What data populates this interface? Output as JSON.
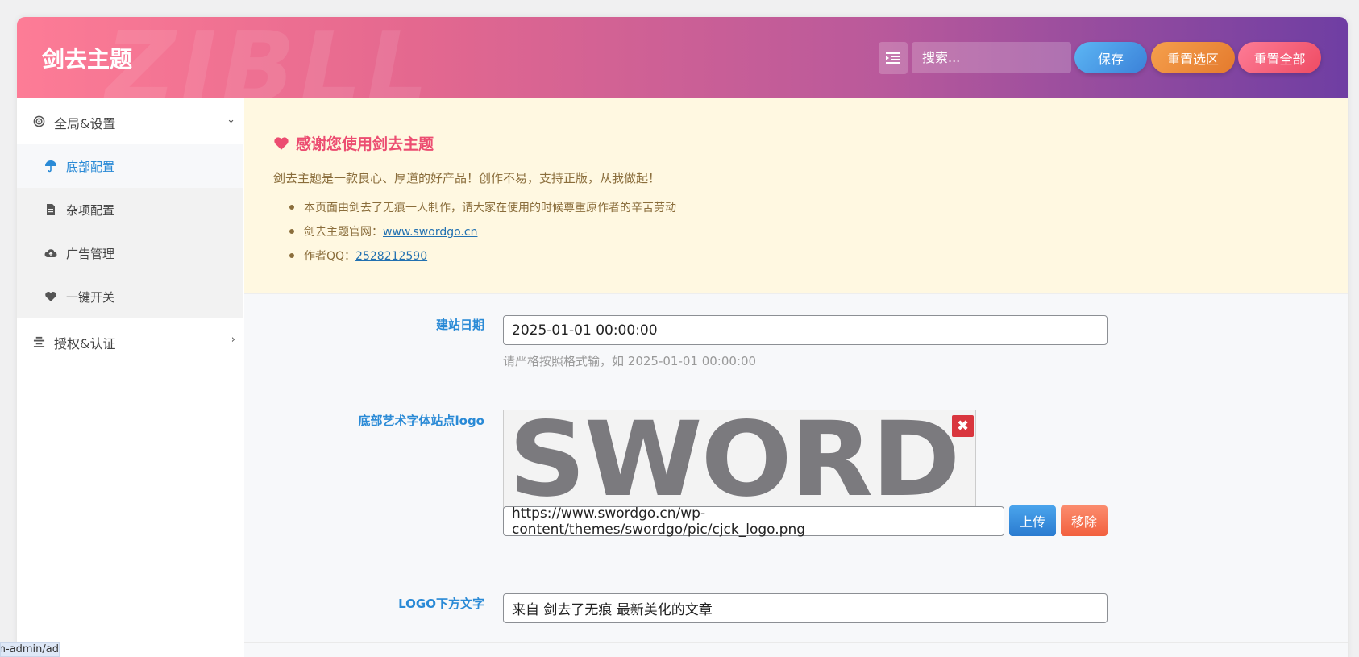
{
  "header": {
    "brand": "剑去主题",
    "watermark": "ZIBLL",
    "search_placeholder": "搜索...",
    "save_label": "保存",
    "reset_section_label": "重置选区",
    "reset_all_label": "重置全部"
  },
  "sidebar": {
    "sections": [
      {
        "label": "全局&设置",
        "icon": "target-icon",
        "expanded": true
      },
      {
        "label": "授权&认证",
        "icon": "align-icon",
        "expanded": false
      }
    ],
    "items": [
      {
        "label": "底部配置",
        "icon": "umbrella-icon",
        "active": true
      },
      {
        "label": "杂项配置",
        "icon": "file-icon",
        "active": false
      },
      {
        "label": "广告管理",
        "icon": "cloud-upload-icon",
        "active": false
      },
      {
        "label": "一键开关",
        "icon": "heart-icon",
        "active": false
      }
    ]
  },
  "notice": {
    "title": "感谢您使用剑去主题",
    "description": "剑去主题是一款良心、厚道的好产品！创作不易，支持正版，从我做起！",
    "bullets": [
      {
        "text": "本页面由剑去了无痕一人制作，请大家在使用的时候尊重原作者的辛苦劳动",
        "link": ""
      },
      {
        "text": "剑去主题官网：",
        "link": "www.swordgo.cn"
      },
      {
        "text": "作者QQ：",
        "link": "2528212590"
      }
    ]
  },
  "fields": {
    "site_date": {
      "label": "建站日期",
      "value": "2025-01-01 00:00:00",
      "help": "请严格按照格式输，如 2025-01-01 00:00:00"
    },
    "footer_logo": {
      "label": "底部艺术字体站点logo",
      "preview_text": "SWORD",
      "url": "https://www.swordgo.cn/wp-content/themes/swordgo/pic/cjck_logo.png",
      "upload_label": "上传",
      "remove_label": "移除"
    },
    "logo_text": {
      "label": "LOGO下方文字",
      "value": "来自 剑去了无痕 最新美化的文章"
    }
  },
  "status_bar": {
    "url_fragment": "n-admin/ad"
  },
  "colors": {
    "accent_blue": "#2a8ad6",
    "accent_pink": "#ec4d71",
    "notice_bg": "#fff8e1"
  }
}
